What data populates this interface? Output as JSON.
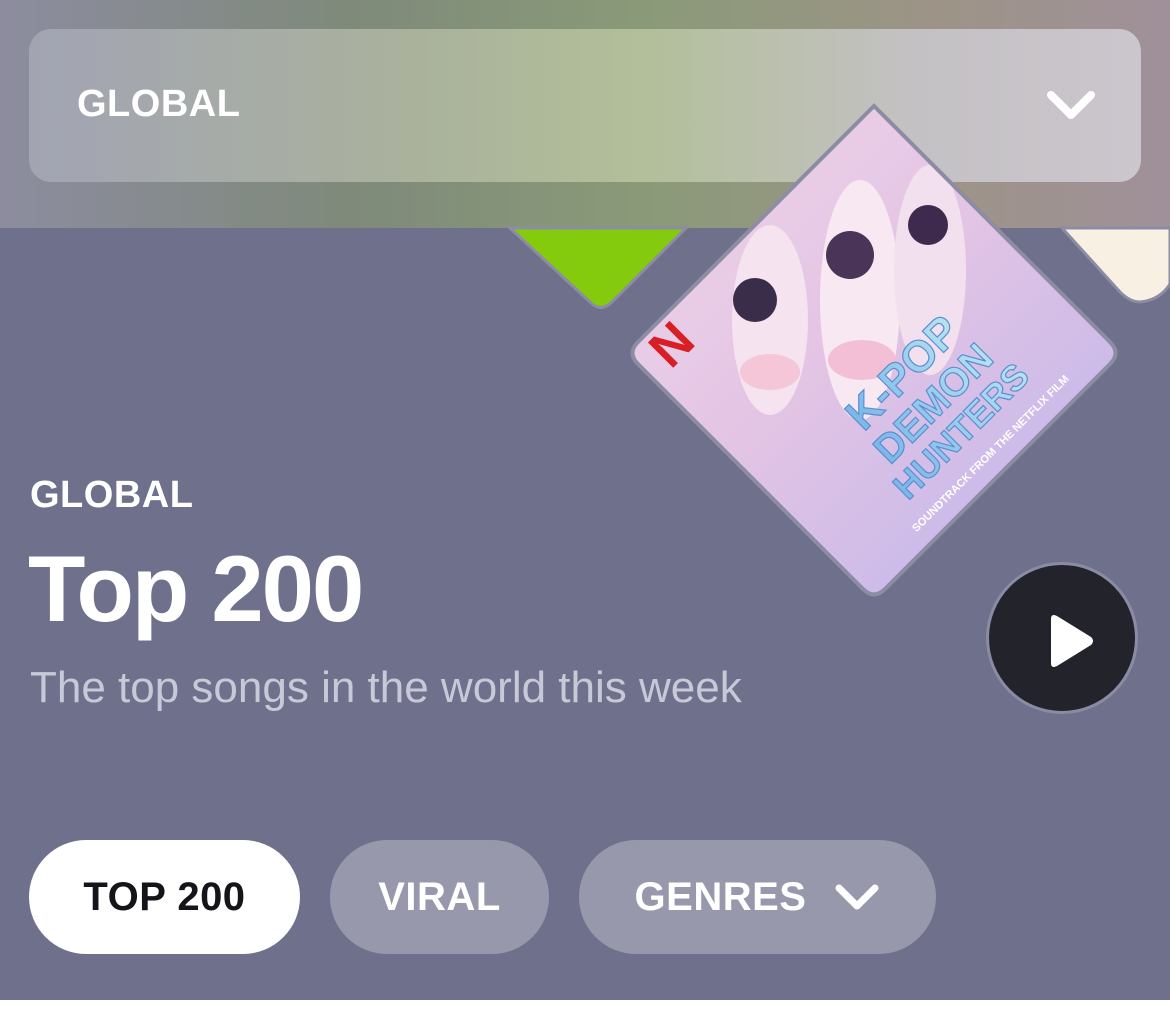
{
  "region_select": {
    "label": "GLOBAL"
  },
  "header": {
    "kicker": "GLOBAL",
    "title": "Top 200",
    "subtitle": "The top songs in the world this week"
  },
  "artwork": {
    "publisher_mark": "N",
    "album_title_line1": "K-POP",
    "album_title_line2": "DEMON",
    "album_title_line3": "HUNTERS",
    "album_caption": "SOUNDTRACK FROM THE NETFLIX FILM"
  },
  "tabs": [
    {
      "label": "TOP 200",
      "selected": true
    },
    {
      "label": "VIRAL",
      "selected": false
    },
    {
      "label": "GENRES",
      "selected": false
    }
  ],
  "colors": {
    "background": "#6f708b",
    "play_button": "#23232b",
    "chip_active": "#ffffff",
    "chip_inactive": "#9898ad"
  },
  "icons": {
    "dropdown": "chevron-down-icon",
    "play": "play-icon"
  }
}
